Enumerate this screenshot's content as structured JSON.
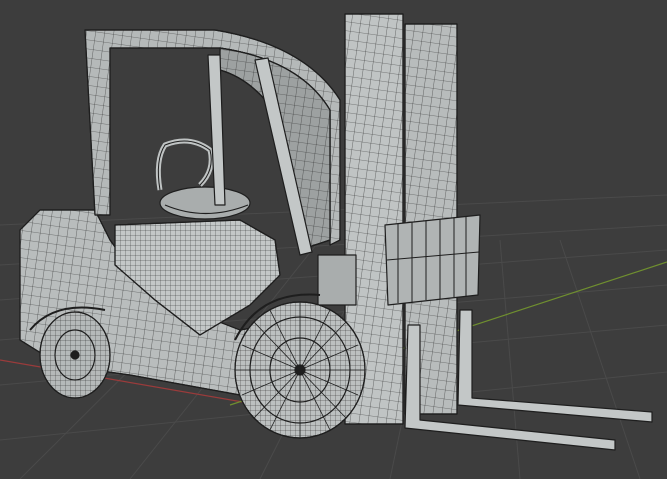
{
  "viewport": {
    "background": "#3d3d3d",
    "grid_color": "#4a4a4a",
    "x_axis_color": "#9a3b3b",
    "y_axis_color": "#6f8f2f"
  },
  "model": {
    "name": "forklift",
    "shading": "solid",
    "overlay": "wireframe",
    "body_color": "#b9bdbd",
    "shadow_color": "#8c9090",
    "wire_color": "#1e1e1e"
  }
}
